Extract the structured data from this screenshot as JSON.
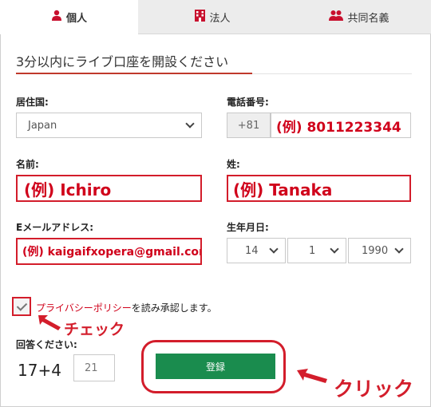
{
  "tabs": [
    {
      "label": "個人",
      "icon": "person-icon",
      "active": true
    },
    {
      "label": "法人",
      "icon": "building-icon",
      "active": false
    },
    {
      "label": "共同名義",
      "icon": "users-icon",
      "active": false
    }
  ],
  "section_title": "3分以内にライブ口座を開設ください",
  "fields": {
    "country": {
      "label": "居住国:",
      "value": "Japan"
    },
    "phone": {
      "label": "電話番号:",
      "prefix": "+81",
      "value": "(例) 8011223344"
    },
    "first_name": {
      "label": "名前:",
      "value": "(例) Ichiro"
    },
    "last_name": {
      "label": "姓:",
      "value": "(例) Tanaka"
    },
    "email": {
      "label": "Eメールアドレス:",
      "value": "(例) kaigaifxopera@gmail.com"
    },
    "birthdate": {
      "label": "生年月日:",
      "day": "14",
      "month": "1",
      "year": "1990"
    }
  },
  "consent": {
    "link_text": "プライバシーポリシー",
    "rest_text": "を読み承認します。",
    "checked": true
  },
  "annotations": {
    "check": "チェック",
    "click": "クリック"
  },
  "captcha": {
    "label": "回答ください:",
    "question": "17+4",
    "answer": "21"
  },
  "submit_label": "登録",
  "colors": {
    "accent_red": "#d31d2b",
    "submit_green": "#1a8c4e",
    "tab_bg": "#ececec"
  }
}
